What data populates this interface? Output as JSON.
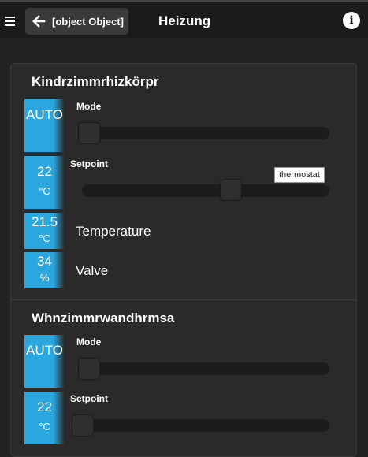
{
  "header": {
    "back_label": "[object Object]",
    "title": "Heizung",
    "info_symbol": "i"
  },
  "sections": [
    {
      "title": "Kindrzimmrhizkörpr",
      "mode": {
        "value": "AUTO",
        "label": "Mode",
        "slider_level": 0.0
      },
      "setpoint": {
        "value": "22",
        "unit": "°C",
        "label": "Setpoint",
        "slider_level": 0.6,
        "tooltip": "thermostat"
      },
      "temperature": {
        "value": "21.5",
        "unit": "°C",
        "label": "Temperature"
      },
      "valve": {
        "value": "34",
        "unit": "%",
        "label": "Valve"
      }
    },
    {
      "title": "Whnzimmrwandhrmsa",
      "mode": {
        "value": "AUTO",
        "label": "Mode",
        "slider_level": 0.0
      },
      "setpoint": {
        "value": "22",
        "unit": "°C",
        "label": "Setpoint",
        "slider_level": 0.0
      }
    }
  ],
  "colors": {
    "accent": "#2aa7df",
    "background": "#222222",
    "panel": "#2a2a2a"
  }
}
